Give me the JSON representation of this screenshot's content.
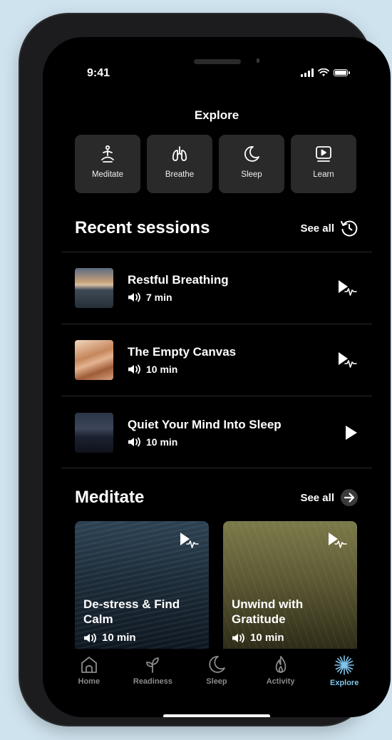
{
  "status_bar": {
    "time": "9:41"
  },
  "header": {
    "title": "Explore"
  },
  "categories": [
    {
      "label": "Meditate",
      "icon": "meditate-icon"
    },
    {
      "label": "Breathe",
      "icon": "lungs-icon"
    },
    {
      "label": "Sleep",
      "icon": "moon-icon"
    },
    {
      "label": "Learn",
      "icon": "video-icon"
    }
  ],
  "recent": {
    "title": "Recent sessions",
    "see_all": "See all",
    "sessions": [
      {
        "title": "Restful Breathing",
        "duration": "7 min"
      },
      {
        "title": "The Empty Canvas",
        "duration": "10 min"
      },
      {
        "title": "Quiet Your Mind Into Sleep",
        "duration": "10 min"
      }
    ]
  },
  "meditate": {
    "title": "Meditate",
    "see_all": "See all",
    "cards": [
      {
        "title": "De-stress & Find Calm",
        "duration": "10 min"
      },
      {
        "title": "Unwind with Gratitude",
        "duration": "10 min"
      }
    ]
  },
  "tabbar": {
    "items": [
      {
        "label": "Home",
        "icon": "home-icon"
      },
      {
        "label": "Readiness",
        "icon": "readiness-icon"
      },
      {
        "label": "Sleep",
        "icon": "moon-icon"
      },
      {
        "label": "Activity",
        "icon": "flame-icon"
      },
      {
        "label": "Explore",
        "icon": "sparkle-icon",
        "active": true
      }
    ]
  },
  "colors": {
    "background": "#000000",
    "tile": "#2a2a2a",
    "accent": "#7fc4ea",
    "page": "#cfe3ee"
  }
}
